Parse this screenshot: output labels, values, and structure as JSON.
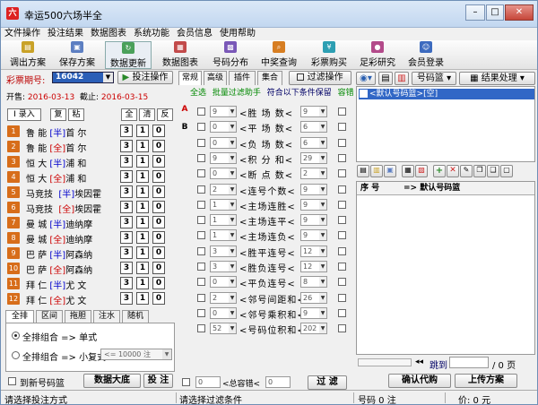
{
  "window": {
    "title": "幸运500六场半全"
  },
  "menu": [
    "文件操作",
    "投注结果",
    "数据图表",
    "系统功能",
    "会员信息",
    "使用帮助"
  ],
  "toolbar": [
    {
      "label": "调出方案",
      "color": "#c9a227"
    },
    {
      "label": "保存方案",
      "color": "#5d7fc2"
    },
    {
      "label": "数据更新",
      "color": "#4aa05a"
    },
    {
      "label": "数据图表",
      "color": "#c24a4a"
    },
    {
      "label": "号码分布",
      "color": "#7a58b8"
    },
    {
      "label": "中奖查询",
      "color": "#d77e22"
    },
    {
      "label": "彩票购买",
      "color": "#2d9fb3"
    },
    {
      "label": "足彩研究",
      "color": "#b34a8a"
    },
    {
      "label": "会员登录",
      "color": "#3d6bbf"
    }
  ],
  "left": {
    "issue_label": "彩票期号:",
    "issue_value": "16042",
    "bet_button": "投注操作",
    "start_label": "开售:",
    "start_date": "2016-03-13",
    "end_label": "截止:",
    "end_date": "2016-03-15",
    "ops": {
      "entry": "录入",
      "copy": "复",
      "paste": "粘",
      "all": "全",
      "clear": "清",
      "invert": "反"
    },
    "matches": [
      {
        "n": "1",
        "a": "鲁",
        "b": "能",
        "t": "半",
        "v": "首",
        "w": "尔"
      },
      {
        "n": "2",
        "a": "鲁",
        "b": "能",
        "t": "全",
        "v": "首",
        "w": "尔"
      },
      {
        "n": "3",
        "a": "恒",
        "b": "大",
        "t": "半",
        "v": "浦",
        "w": "和"
      },
      {
        "n": "4",
        "a": "恒",
        "b": "大",
        "t": "全",
        "v": "浦",
        "w": "和"
      },
      {
        "n": "5",
        "a": "马竞技",
        "b": "",
        "t": "半",
        "v": "埃因霍",
        "w": ""
      },
      {
        "n": "6",
        "a": "马竞技",
        "b": "",
        "t": "全",
        "v": "埃因霍",
        "w": ""
      },
      {
        "n": "7",
        "a": "曼",
        "b": "城",
        "t": "半",
        "v": "迪纳摩",
        "w": ""
      },
      {
        "n": "8",
        "a": "曼",
        "b": "城",
        "t": "全",
        "v": "迪纳摩",
        "w": ""
      },
      {
        "n": "9",
        "a": "巴",
        "b": "萨",
        "t": "半",
        "v": "阿森纳",
        "w": ""
      },
      {
        "n": "10",
        "a": "巴",
        "b": "萨",
        "t": "全",
        "v": "阿森纳",
        "w": ""
      },
      {
        "n": "11",
        "a": "拜",
        "b": "仁",
        "t": "半",
        "v": "尤",
        "w": "文"
      },
      {
        "n": "12",
        "a": "拜",
        "b": "仁",
        "t": "全",
        "v": "尤",
        "w": "文"
      }
    ],
    "odds": [
      "3",
      "1",
      "0"
    ],
    "tabs": [
      "全排",
      "区间",
      "拖胆",
      "注水",
      "随机"
    ],
    "opt1": "全排组合 => 单式",
    "opt2": "全排组合 => 小复式",
    "opt2_value": "<= 10000 注",
    "to_new": "到新号码篮",
    "big_data": "数据大底",
    "bet": "投 注"
  },
  "mid": {
    "tabs": [
      "常规",
      "高级",
      "插件",
      "集合"
    ],
    "filter_btn": "过滤操作",
    "bar": {
      "all": "全选",
      "helper": "批量过滤助手",
      "note": "符合以下条件保留",
      "tol": "容错"
    },
    "rows": [
      {
        "a": "9",
        "b": "9",
        "label": "胜 场 数"
      },
      {
        "a": "0",
        "b": "6",
        "label": "平 场 数"
      },
      {
        "a": "0",
        "b": "6",
        "label": "负 场 数"
      },
      {
        "a": "9",
        "b": "29",
        "label": "积 分 和"
      },
      {
        "a": "0",
        "b": "2",
        "label": "断 点 数"
      },
      {
        "a": "2",
        "b": "9",
        "label": "连号个数"
      },
      {
        "a": "1",
        "b": "9",
        "label": "主场连胜"
      },
      {
        "a": "1",
        "b": "9",
        "label": "主场连平"
      },
      {
        "a": "1",
        "b": "9",
        "label": "主场连负"
      },
      {
        "a": "3",
        "b": "12",
        "label": "胜平连号"
      },
      {
        "a": "3",
        "b": "12",
        "label": "胜负连号"
      },
      {
        "a": "0",
        "b": "8",
        "label": "平负连号"
      },
      {
        "a": "2",
        "b": "26",
        "label": "邻号间距和"
      },
      {
        "a": "0",
        "b": "9",
        "label": "邻号乘积和"
      },
      {
        "a": "52",
        "b": "202",
        "label": "号码位积和"
      }
    ],
    "tol_label": "<总容错<",
    "tol_a": "0",
    "tol_b": "0",
    "filter": "过 滤"
  },
  "right": {
    "basket": "号码篮",
    "result": "结果处理",
    "item": "<默认号码篮>[空]",
    "col_no": "序  号",
    "col_name": "=> 默认号码篮",
    "jump": "跳到",
    "page": "/ 0 页",
    "confirm": "确认代购",
    "upload": "上传方案"
  },
  "status": {
    "left": "请选择投注方式",
    "mid": "请选择过滤条件",
    "count": "号码 0 注",
    "amount": "价: 0 元"
  }
}
